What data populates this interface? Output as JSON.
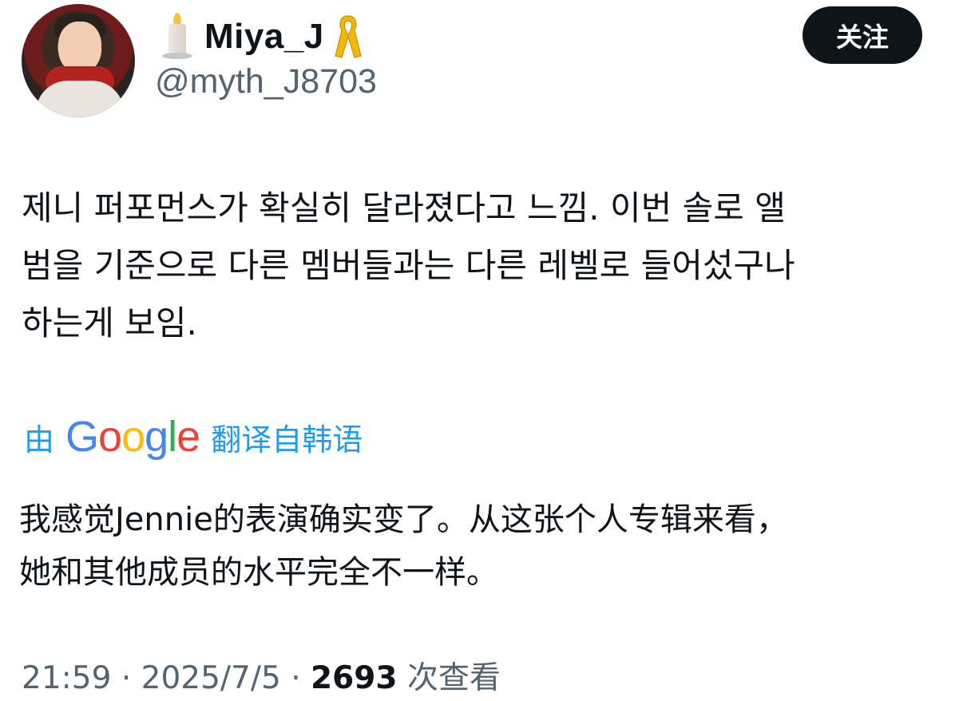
{
  "author": {
    "display_name": "Miya_J",
    "handle": "@myth_J8703",
    "name_emojis": [
      "candle-icon",
      "yellow-ribbon-icon"
    ]
  },
  "follow_button": {
    "label": "关注"
  },
  "tweet": {
    "text_lines": [
      "제니 퍼포먼스가 확실히 달라졌다고 느낌. 이번 솔로 앨",
      "범을 기준으로 다른 멤버들과는 다른 레벨로 들어섰구나",
      "하는게 보임."
    ]
  },
  "translation": {
    "prefix": "由",
    "logo_text": "Google",
    "suffix": "翻译自韩语",
    "text_lines": [
      "我感觉Jennie的表演确实变了。从这张个人专辑来看，",
      "她和其他成员的水平完全不一样。"
    ]
  },
  "meta": {
    "time": "21:59",
    "separator": "·",
    "date": "2025/7/5",
    "views_count": "2693",
    "views_label": "次查看"
  },
  "colors": {
    "link_blue": "#1d9bf0",
    "secondary_text": "#536471",
    "button_bg": "#0f1419"
  }
}
